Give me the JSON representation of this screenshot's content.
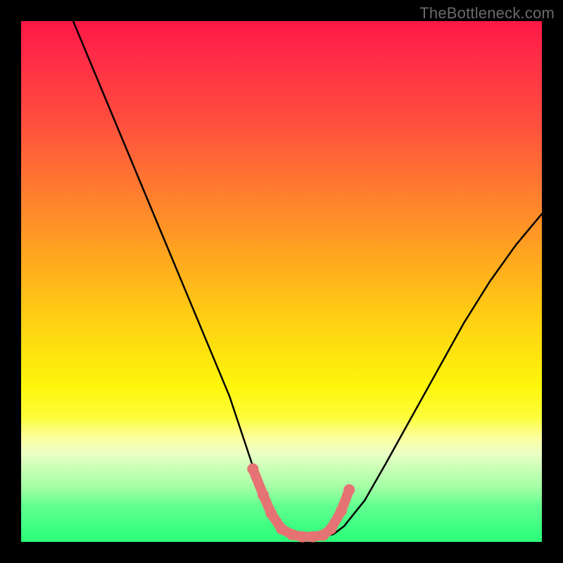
{
  "watermark": {
    "text": "TheBottleneck.com"
  },
  "colors": {
    "frame": "#000000",
    "curve": "#000000",
    "marker": "#e57373",
    "gradient_stops": [
      [
        "0%",
        "#ff1846"
      ],
      [
        "18%",
        "#ff4a3f"
      ],
      [
        "45%",
        "#ffa61f"
      ],
      [
        "70%",
        "#fdf60b"
      ],
      [
        "85%",
        "#c8ffb6"
      ],
      [
        "100%",
        "#2cff79"
      ]
    ]
  },
  "chart_data": {
    "type": "line",
    "title": "",
    "xlabel": "",
    "ylabel": "",
    "xlim": [
      0,
      100
    ],
    "ylim": [
      0,
      100
    ],
    "note": "x/y in percent of plot area; y=0 is bottom; color gradient encodes y (bottleneck) from red (high) to green (low)",
    "series": [
      {
        "name": "bottleneck-curve",
        "x": [
          10,
          15,
          20,
          25,
          30,
          35,
          40,
          44,
          46,
          48,
          50,
          52,
          54,
          56,
          58,
          60,
          62,
          66,
          70,
          75,
          80,
          85,
          90,
          95,
          100
        ],
        "y": [
          100,
          88,
          76,
          64,
          52,
          40,
          28,
          16,
          10,
          6,
          3,
          1.5,
          1,
          1,
          1,
          1.5,
          3,
          8,
          15,
          24,
          33,
          42,
          50,
          57,
          63
        ]
      }
    ],
    "markers": {
      "name": "highlighted-points",
      "x": [
        44.5,
        46.5,
        48.0,
        50.0,
        52.0,
        54.0,
        56.0,
        58.0,
        59.5,
        61.5,
        63.0
      ],
      "y": [
        14.0,
        9.0,
        5.5,
        2.5,
        1.4,
        1.0,
        1.0,
        1.3,
        2.5,
        6.0,
        10.0
      ]
    }
  }
}
